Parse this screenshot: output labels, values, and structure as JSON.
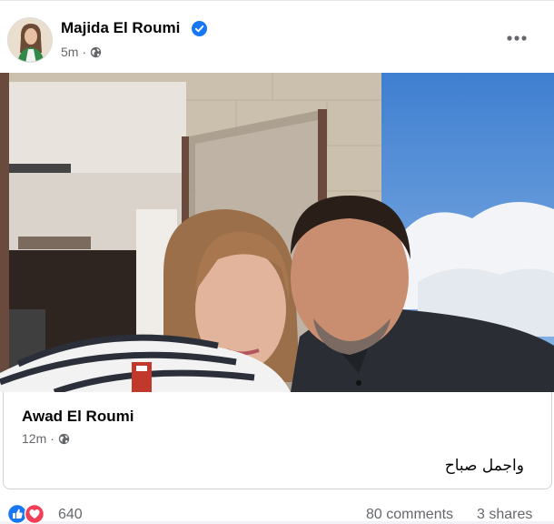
{
  "post": {
    "author": "Majida El Roumi",
    "verified": true,
    "time": "5m",
    "audience_icon": "globe-icon",
    "more_icon": "more-horizontal-icon"
  },
  "shared_post": {
    "author": "Awad El Roumi",
    "time": "12m",
    "audience_icon": "globe-icon",
    "text": "واجمل صباح"
  },
  "footer": {
    "reactions": [
      "like-reaction-icon",
      "love-reaction-icon"
    ],
    "reaction_count": "640",
    "comments": "80 comments",
    "shares": "3 shares"
  },
  "colors": {
    "brand_blue": "#1877f2",
    "love_red": "#f33e58",
    "secondary_text": "#65676b"
  }
}
